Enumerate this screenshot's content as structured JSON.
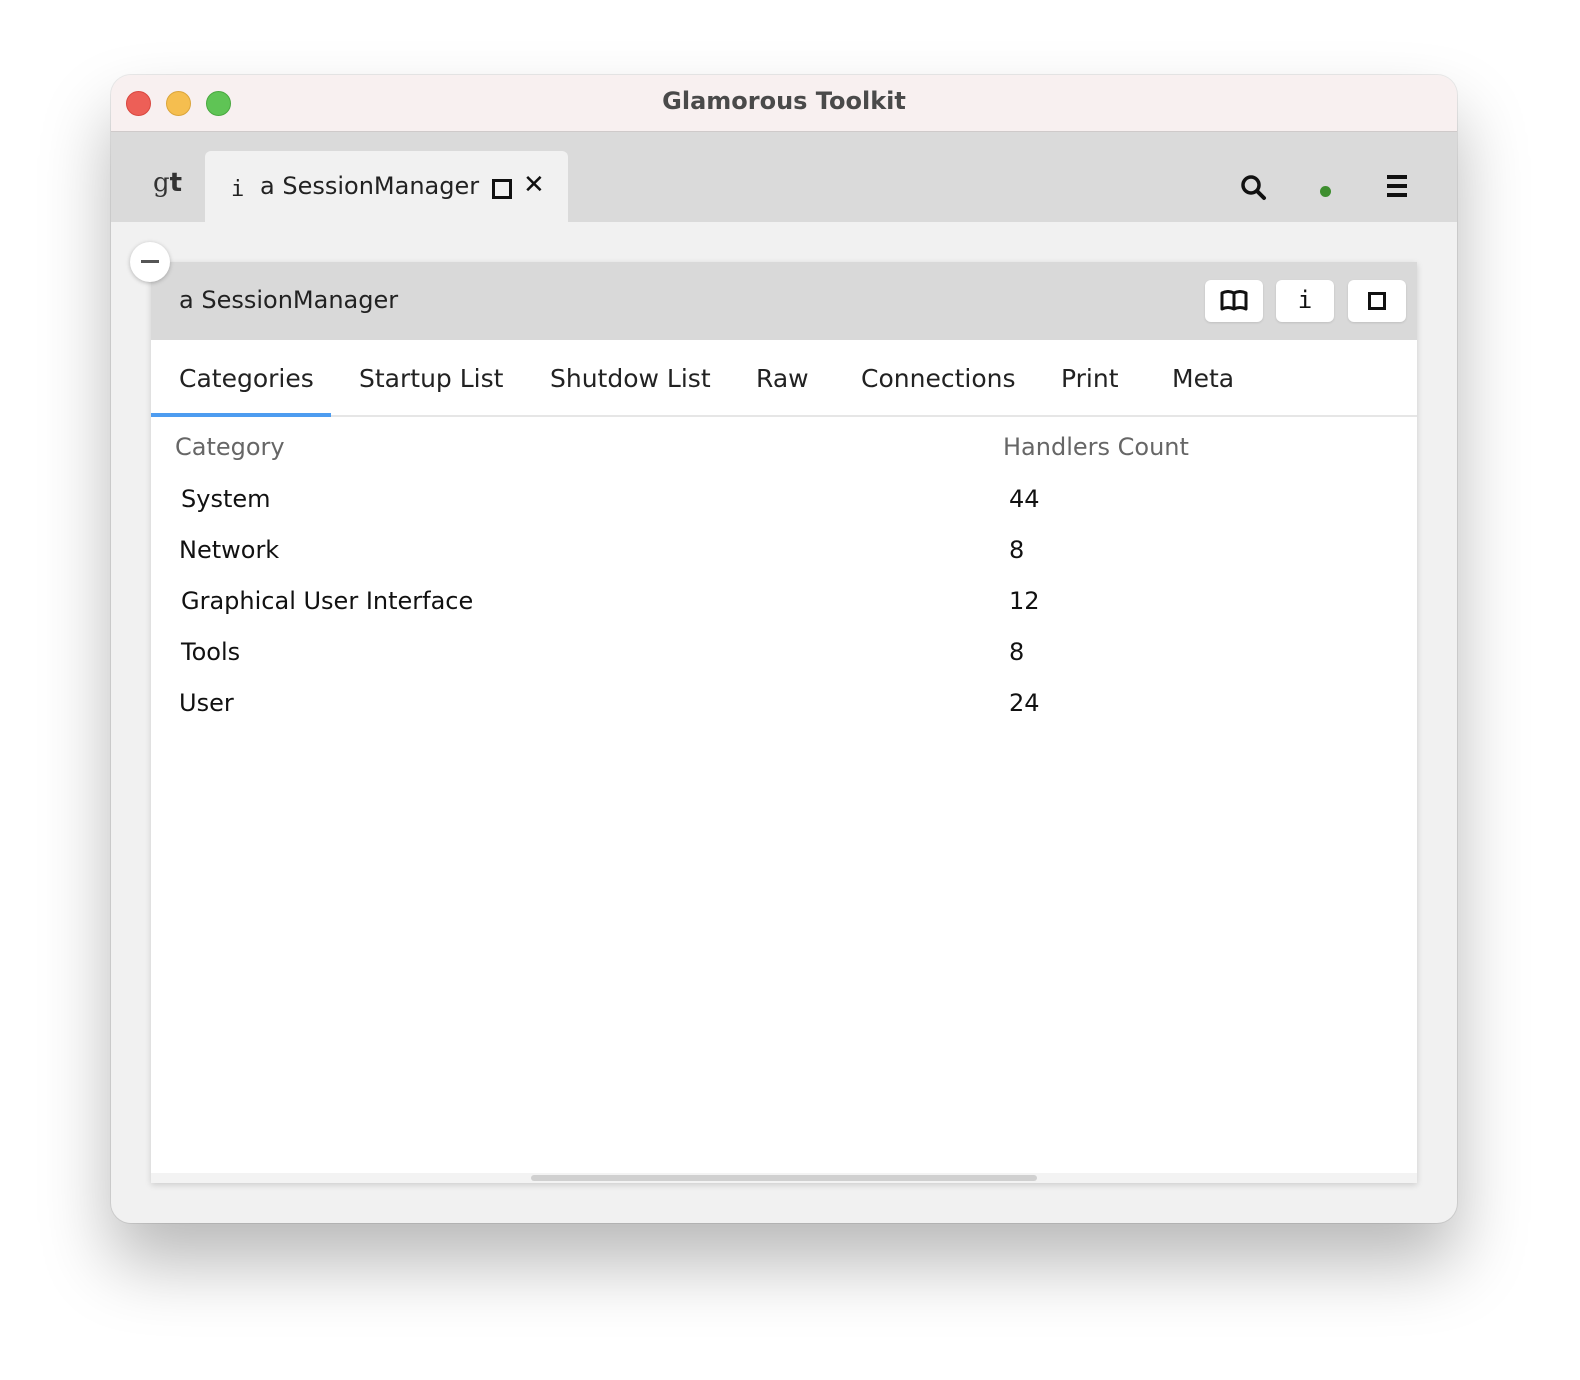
{
  "window": {
    "title": "Glamorous Toolkit"
  },
  "tabbar": {
    "logo": {
      "g": "g",
      "t": "t"
    },
    "tab": {
      "icon": "i",
      "label": "a SessionManager"
    }
  },
  "panel": {
    "title": "a SessionManager",
    "info_glyph": "i",
    "view_tabs": [
      "Categories",
      "Startup List",
      "Shutdow List",
      "Raw",
      "Connections",
      "Print",
      "Meta"
    ],
    "active_tab": "Categories",
    "columns": {
      "category": "Category",
      "count": "Handlers Count"
    },
    "rows": [
      {
        "category": "System",
        "count": "44"
      },
      {
        "category": "Network",
        "count": "8"
      },
      {
        "category": "Graphical User Interface",
        "count": "12"
      },
      {
        "category": "Tools",
        "count": "8"
      },
      {
        "category": "User",
        "count": "24"
      }
    ]
  },
  "colors": {
    "accent_underline": "#4d9cf0",
    "status_dot": "#3e8e2f"
  }
}
